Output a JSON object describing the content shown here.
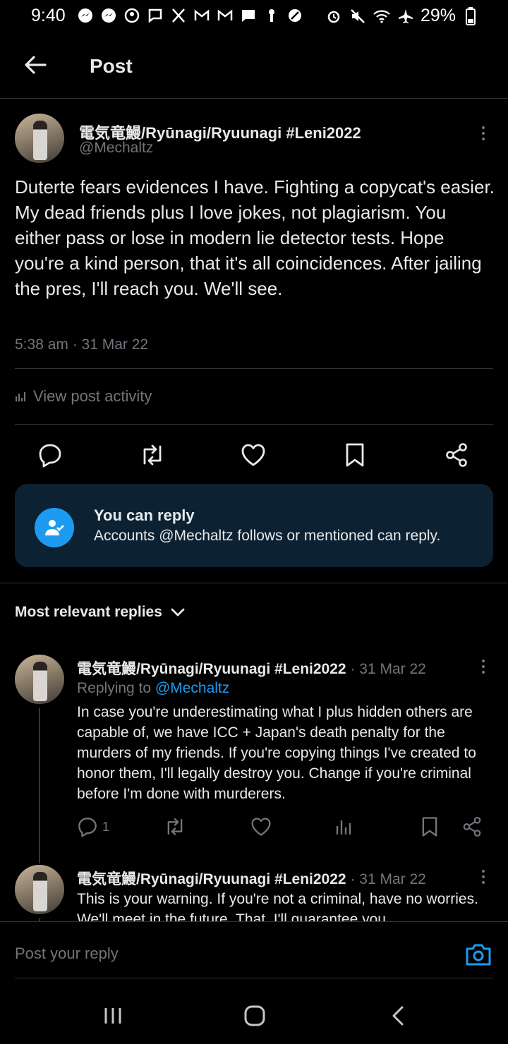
{
  "status_bar": {
    "time": "9:40",
    "battery": "29%"
  },
  "header": {
    "title": "Post"
  },
  "post": {
    "author_name": "電気竜鰻/Ryūnagi/Ryuunagi #Leni2022",
    "handle": "@Mechaltz",
    "body": "Duterte fears evidences I have. Fighting a copycat's easier. My dead friends plus I love jokes, not plagiarism. You either pass or lose in modern lie detector tests. Hope you're a kind person, that it's all coincidences. After jailing the pres, I'll reach you. We'll see.",
    "timestamp": "5:38 am · 31 Mar 22",
    "activity_label": "View post activity"
  },
  "reply_permission": {
    "title": "You can reply",
    "text": "Accounts @Mechaltz follows or mentioned can reply."
  },
  "sort_label": "Most relevant replies",
  "replies": [
    {
      "author_name": "電気竜鰻/Ryūnagi/Ryuunagi #Leni2022",
      "date": "· 31 Mar 22",
      "replying_prefix": "Replying to",
      "replying_to": "@Mechaltz",
      "body": "In case you're underestimating what I plus hidden others are capable of, we have ICC + Japan's death penalty for the murders of my friends. If you're copying things I've created to honor them, I'll legally destroy you. Change if you're criminal before I'm done with murderers.",
      "reply_count": "1"
    },
    {
      "author_name": "電気竜鰻/Ryūnagi/Ryuunagi #Leni2022",
      "date": "· 31 Mar 22",
      "body": "This is your warning. If you're not a criminal, have no worries. We'll meet in the future. That, I'll guarantee you."
    }
  ],
  "compose": {
    "placeholder": "Post your reply"
  },
  "colors": {
    "accent": "#1d9bf0",
    "background": "#000000",
    "muted": "#71767b",
    "card": "#0c2233"
  },
  "icons": [
    "back-arrow-icon",
    "more-icon",
    "reply-icon",
    "repost-icon",
    "like-icon",
    "bookmark-icon",
    "share-icon",
    "analytics-icon",
    "person-check-icon",
    "chevron-down-icon",
    "camera-icon",
    "recents-icon",
    "home-icon",
    "back-icon"
  ]
}
